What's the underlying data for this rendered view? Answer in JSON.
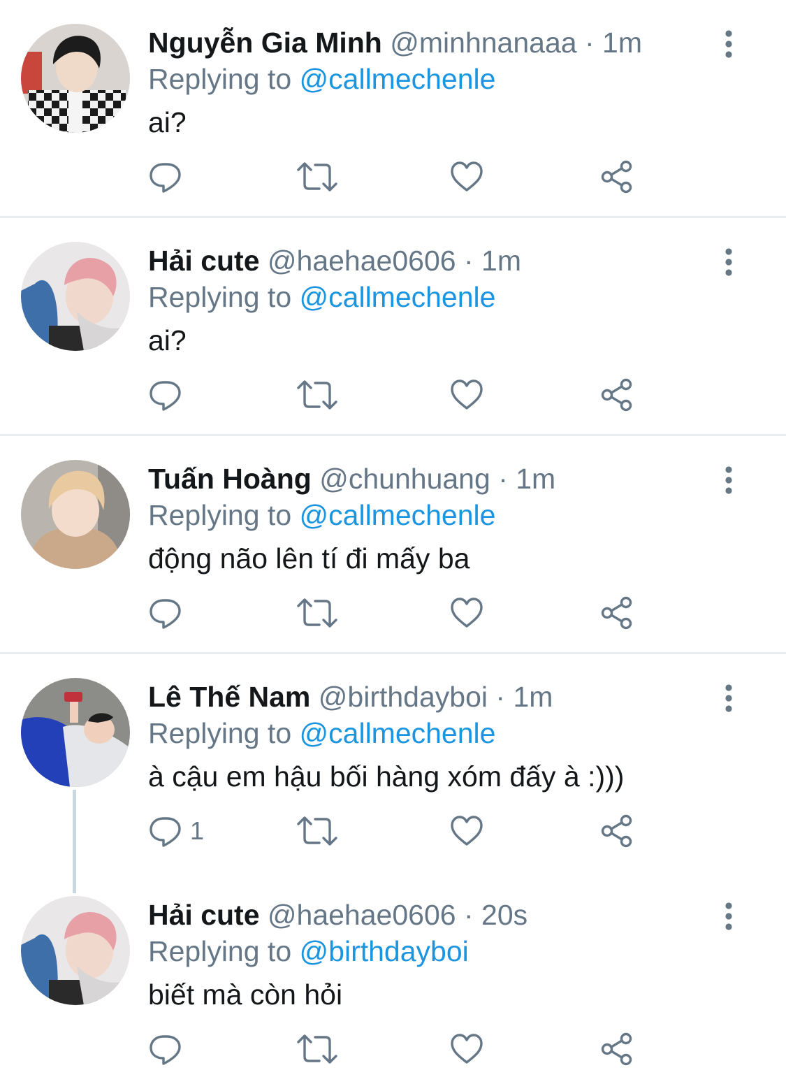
{
  "replies": [
    {
      "name": "Nguyễn Gia Minh",
      "handle": "@minhnanaaa",
      "dot": "·",
      "time": "1m",
      "replying_prefix": "Replying to",
      "replying_to": "@callmechenle",
      "text": "ai?",
      "reply_count": "",
      "avatar": "checkered-cardigan-portrait"
    },
    {
      "name": "Hải cute",
      "handle": "@haehae0606",
      "dot": "·",
      "time": "1m",
      "replying_prefix": "Replying to",
      "replying_to": "@callmechenle",
      "text": "ai?",
      "reply_count": "",
      "avatar": "pink-hair-sleeping-portrait"
    },
    {
      "name": "Tuấn Hoàng",
      "handle": "@chunhuang",
      "dot": "·",
      "time": "1m",
      "replying_prefix": "Replying to",
      "replying_to": "@callmechenle",
      "text": "động não lên tí đi mấy ba",
      "reply_count": "",
      "avatar": "blond-hoodie-portrait"
    },
    {
      "name": "Lê Thế Nam",
      "handle": "@birthdayboi",
      "dot": "·",
      "time": "1m",
      "replying_prefix": "Replying to",
      "replying_to": "@callmechenle",
      "text": "à cậu em hậu bối hàng xóm đấy à :)))",
      "reply_count": "1",
      "avatar": "lying-on-floor-portrait"
    },
    {
      "name": "Hải cute",
      "handle": "@haehae0606",
      "dot": "·",
      "time": "20s",
      "replying_prefix": "Replying to",
      "replying_to": "@birthdayboi",
      "text": "biết mà còn hỏi",
      "reply_count": "",
      "avatar": "pink-hair-sleeping-portrait"
    }
  ],
  "icons": {
    "reply": "reply-icon",
    "retweet": "retweet-icon",
    "like": "heart-icon",
    "share": "share-icon",
    "more": "more-vertical-icon"
  },
  "colors": {
    "name": "#14171a",
    "secondary": "#657786",
    "mention": "#1b95e0",
    "divider": "#e6ecf0",
    "thread_line": "#ccd6dd"
  }
}
